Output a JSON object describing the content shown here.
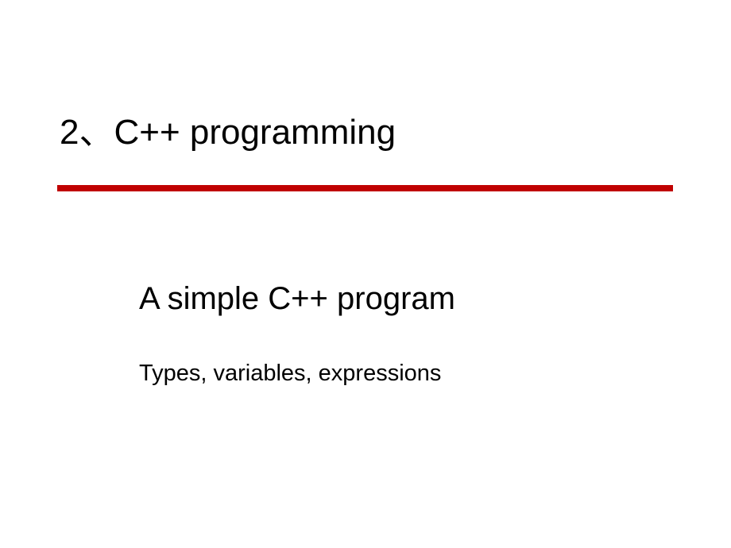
{
  "title": "2、C++ programming",
  "subtitle": "A simple C++ program",
  "description": "Types, variables, expressions"
}
